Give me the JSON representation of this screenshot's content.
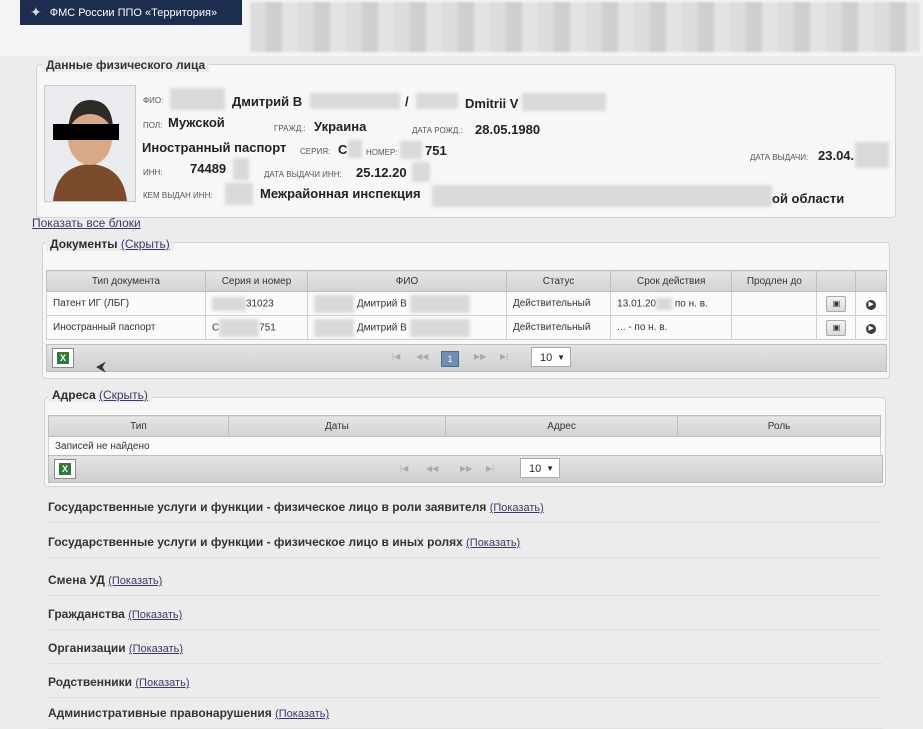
{
  "header": {
    "app_title": "ФМС России ППО «Территория»",
    "logo_icon": "eagle-emblem-icon"
  },
  "person": {
    "legend": "Данные физического лица",
    "fio_label": "ФИО:",
    "fio_ru": "Дмитрий В",
    "fio_sep": "/",
    "fio_en": "Dmitrii V",
    "pol_label": "ПОЛ:",
    "pol": "Мужской",
    "grazhd_label": "ГРАЖД.:",
    "grazhd": "Украина",
    "dob_label": "ДАТА РОЖД.:",
    "dob": "28.05.1980",
    "doc_type": "Иностранный паспорт",
    "seria_label": "СЕРИЯ:",
    "seria": "С",
    "nomer_label": "НОМЕР:",
    "nomer": "751",
    "issue_date_label": "ДАТА ВЫДАЧИ:",
    "issue_date": "23.04.",
    "inn_label": "ИНН:",
    "inn": "74489",
    "inn_date_label": "ДАТА ВЫДАЧИ ИНН:",
    "inn_date": "25.12.20",
    "issued_by_label": "КЕМ ВЫДАН ИНН:",
    "issued_by": "Межрайонная инспекция",
    "issued_by_tail": "ой области"
  },
  "show_all_link": "Показать все блоки",
  "documents": {
    "title": "Документы",
    "toggle": "(Скрыть)",
    "columns": [
      "Тип документа",
      "Серия и номер",
      "ФИО",
      "Статус",
      "Срок действия",
      "Продлен до"
    ],
    "rows": [
      {
        "type": "Патент ИГ (ЛБГ)",
        "number": "31023",
        "fio": "Дмитрий В",
        "status": "Действительный",
        "valid": "13.01.20",
        "valid_tail": "по н. в.",
        "extended": ""
      },
      {
        "type": "Иностранный паспорт",
        "number": "С",
        "number_tail": "751",
        "fio": "Дмитрий В",
        "status": "Действительный",
        "valid": "...",
        "valid_tail": "- по н. в.",
        "extended": ""
      }
    ],
    "pager": {
      "page": "1",
      "page_size": "10"
    }
  },
  "addresses": {
    "title": "Адреса",
    "toggle": "(Скрыть)",
    "columns": [
      "Тип",
      "Даты",
      "Адрес",
      "Роль"
    ],
    "empty": "Записей не найдено",
    "pager": {
      "page_size": "10"
    }
  },
  "sections": [
    {
      "title": "Государственные услуги и функции - физическое лицо в роли заявителя",
      "toggle": "(Показать)"
    },
    {
      "title": "Государственные услуги и функции - физическое лицо в иных ролях",
      "toggle": "(Показать)"
    },
    {
      "title": "Смена УД",
      "toggle": "(Показать)"
    },
    {
      "title": "Гражданства",
      "toggle": "(Показать)"
    },
    {
      "title": "Организации",
      "toggle": "(Показать)"
    },
    {
      "title": "Родственники",
      "toggle": "(Показать)"
    },
    {
      "title": "Административные правонарушения",
      "toggle": "(Показать)"
    }
  ]
}
